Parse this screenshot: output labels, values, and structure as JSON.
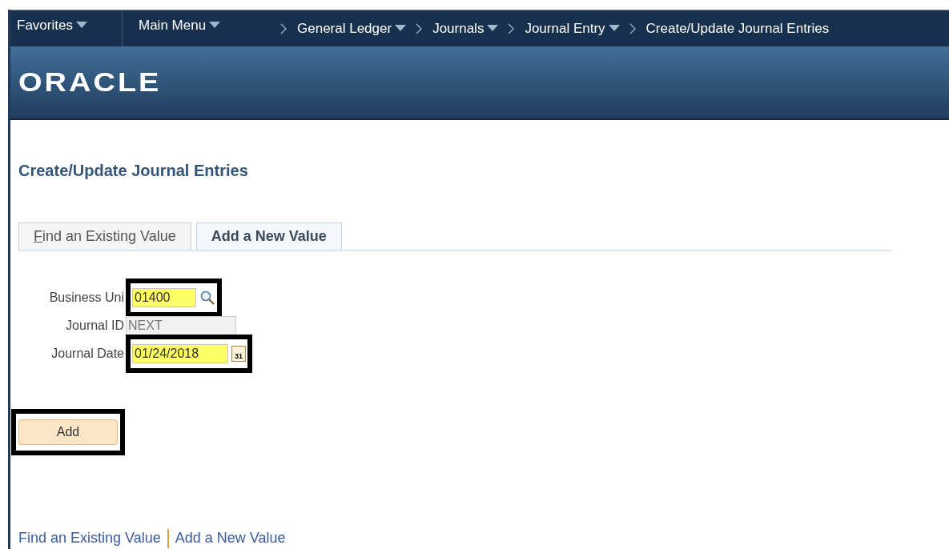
{
  "nav": {
    "items": [
      {
        "label": "Favorites",
        "dropdown": true
      },
      {
        "label": "Main Menu",
        "dropdown": true
      }
    ],
    "breadcrumbs": [
      {
        "label": "General Ledger",
        "dropdown": true
      },
      {
        "label": "Journals",
        "dropdown": true
      },
      {
        "label": "Journal Entry",
        "dropdown": true
      },
      {
        "label": "Create/Update Journal Entries",
        "dropdown": false
      }
    ]
  },
  "banner": {
    "logo": "ORACLE"
  },
  "page_title": "Create/Update Journal Entries",
  "tabs": [
    {
      "label": "Find an Existing Value",
      "selected": false
    },
    {
      "label": "Add a New Value",
      "selected": true
    }
  ],
  "fields": [
    {
      "label": "Business Uni",
      "value": "01400",
      "kind": "lookup",
      "highlighted": true,
      "disabled": false
    },
    {
      "label": "Journal ID",
      "value": "NEXT",
      "kind": "plain",
      "highlighted": false,
      "disabled": true
    },
    {
      "label": "Journal Date",
      "value": "01/24/2018",
      "kind": "date",
      "highlighted": true,
      "disabled": false
    }
  ],
  "add_button": {
    "label": "Add",
    "highlighted": true
  },
  "calendar_icon_text": "31",
  "bottom_links": [
    {
      "label": "Find an Existing Value"
    },
    {
      "label": "Add a New Value"
    }
  ]
}
